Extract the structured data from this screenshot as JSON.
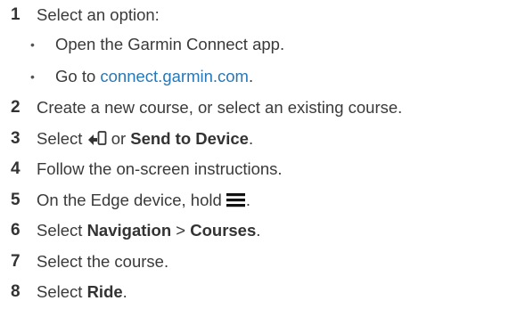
{
  "steps": [
    {
      "num": "1",
      "text": "Select an option:"
    },
    {
      "num": "2",
      "text": "Create a new course, or select an existing course."
    },
    {
      "num": "3",
      "pre": "Select ",
      "mid": " or ",
      "bold": "Send to Device",
      "post": "."
    },
    {
      "num": "4",
      "text": "Follow the on-screen instructions."
    },
    {
      "num": "5",
      "pre": "On the Edge device, hold ",
      "post": "."
    },
    {
      "num": "6",
      "pre": "Select ",
      "bold1": "Navigation",
      "mid": " > ",
      "bold2": "Courses",
      "post": "."
    },
    {
      "num": "7",
      "text": "Select the course."
    },
    {
      "num": "8",
      "pre": "Select ",
      "bold": "Ride",
      "post": "."
    }
  ],
  "sub_options": [
    {
      "bullet": "•",
      "text": "Open the Garmin Connect app."
    },
    {
      "bullet": "•",
      "pre": "Go to ",
      "link": "connect.garmin.com",
      "post": "."
    }
  ],
  "icons": {
    "send": "send-to-device-icon",
    "menu": "menu-icon"
  },
  "colors": {
    "text": "#3a3a3a",
    "link": "#2878b8"
  }
}
